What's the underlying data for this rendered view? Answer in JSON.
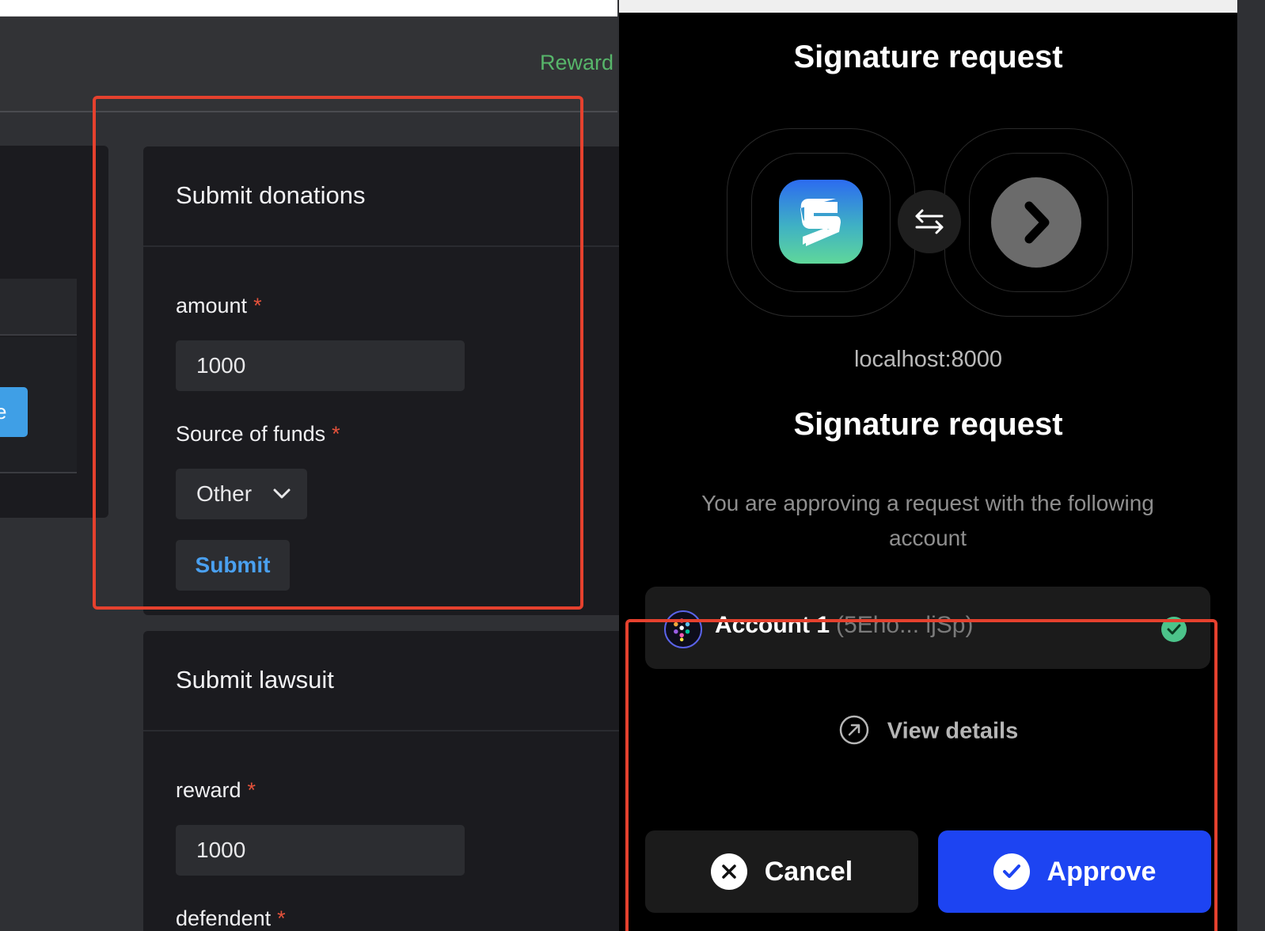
{
  "header": {
    "nav_reward": "Reward"
  },
  "left_card": {
    "button_fragment": "e"
  },
  "donations": {
    "title": "Submit donations",
    "amount_label": "amount",
    "amount_value": "1000",
    "source_label": "Source of funds",
    "source_value": "Other",
    "required_mark": "*",
    "submit_label": "Submit"
  },
  "lawsuit": {
    "title": "Submit lawsuit",
    "reward_label": "reward",
    "reward_value": "1000",
    "defendent_label": "defendent",
    "required_mark": "*"
  },
  "popup": {
    "title": "Signature request",
    "host": "localhost:8000",
    "subtitle": "Signature request",
    "description": "You are approving a request with the following account",
    "account_name": "Account 1",
    "account_address": "(5Eho... ljSp)",
    "view_details": "View details",
    "cancel_label": "Cancel",
    "approve_label": "Approve"
  },
  "colors": {
    "accent_blue": "#1d44f2",
    "annotation_red": "#e5412e",
    "reward_green": "#57b56a",
    "success_green": "#4cc38a"
  },
  "icons": [
    "swap-icon",
    "chevron-right-icon",
    "chevron-down-icon",
    "arrow-up-right-icon",
    "close-icon",
    "check-icon",
    "app-logo-icon",
    "account-avatar-icon"
  ]
}
